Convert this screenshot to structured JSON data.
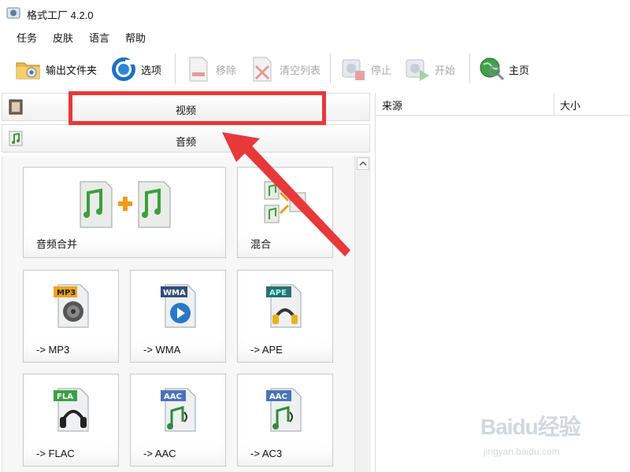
{
  "window": {
    "title": "格式工厂 4.2.0"
  },
  "menu": {
    "items": [
      "任务",
      "皮肤",
      "语言",
      "帮助"
    ]
  },
  "toolbar": {
    "output_folder": "输出文件夹",
    "options": "选项",
    "remove": "移除",
    "clear_list": "清空列表",
    "stop": "停止",
    "start": "开始",
    "home": "主页"
  },
  "categories": {
    "video": "视频",
    "audio": "音频"
  },
  "tiles": {
    "audio_merge": "音频合并",
    "mix": "混合",
    "mp3": "-> MP3",
    "wma": "-> WMA",
    "ape": "-> APE",
    "flac": "-> FLAC",
    "aac": "-> AAC",
    "ac3": "-> AC3"
  },
  "badges": {
    "mp3": "MP3",
    "wma": "WMA",
    "ape": "APE",
    "fla": "FLA",
    "aac": "AAC",
    "ac3": "AAC"
  },
  "list": {
    "col_source": "来源",
    "col_size": "大小"
  },
  "watermark": {
    "logo": "Baidu经验",
    "sub": "jingyan.baidu.com"
  },
  "colors": {
    "highlight": "#e8383a",
    "disabled_text": "#a8a8a8"
  }
}
